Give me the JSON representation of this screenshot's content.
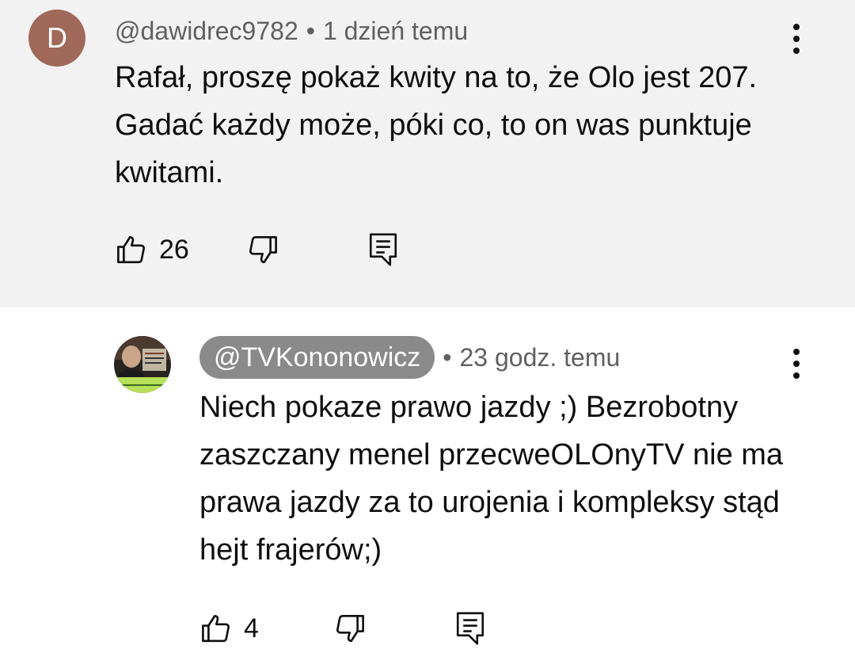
{
  "comments": [
    {
      "avatar_letter": "D",
      "avatar_color": "#a0695a",
      "handle": "@dawidrec9782",
      "separator": "•",
      "time": "1 dzień temu",
      "text": "Rafał, proszę pokaż kwity na to, że Olo jest 207. Gadać każdy może, póki co, to on was punktuje kwitami.",
      "likes": "26",
      "icons": {
        "like": "thumb-up-icon",
        "dislike": "thumb-down-icon",
        "reply": "reply-comment-icon",
        "menu": "more-vert-icon"
      }
    },
    {
      "avatar_image": "channel-avatar",
      "handle": "@TVKononowicz",
      "handle_highlight_color": "#8a8a8a",
      "separator": "•",
      "time": "23 godz. temu",
      "text": "Niech pokaze prawo jazdy ;) Bezrobotny zaszczany menel przecweOLOnyTV nie ma prawa jazdy za to urojenia i kompleksy stąd hejt frajerów;)",
      "likes": "4",
      "icons": {
        "like": "thumb-up-icon",
        "dislike": "thumb-down-icon",
        "reply": "reply-comment-icon",
        "menu": "more-vert-icon"
      }
    }
  ],
  "colors": {
    "highlight_background": "#f2f2f2",
    "meta_text": "#606060",
    "body_text": "#0f0f0f"
  }
}
